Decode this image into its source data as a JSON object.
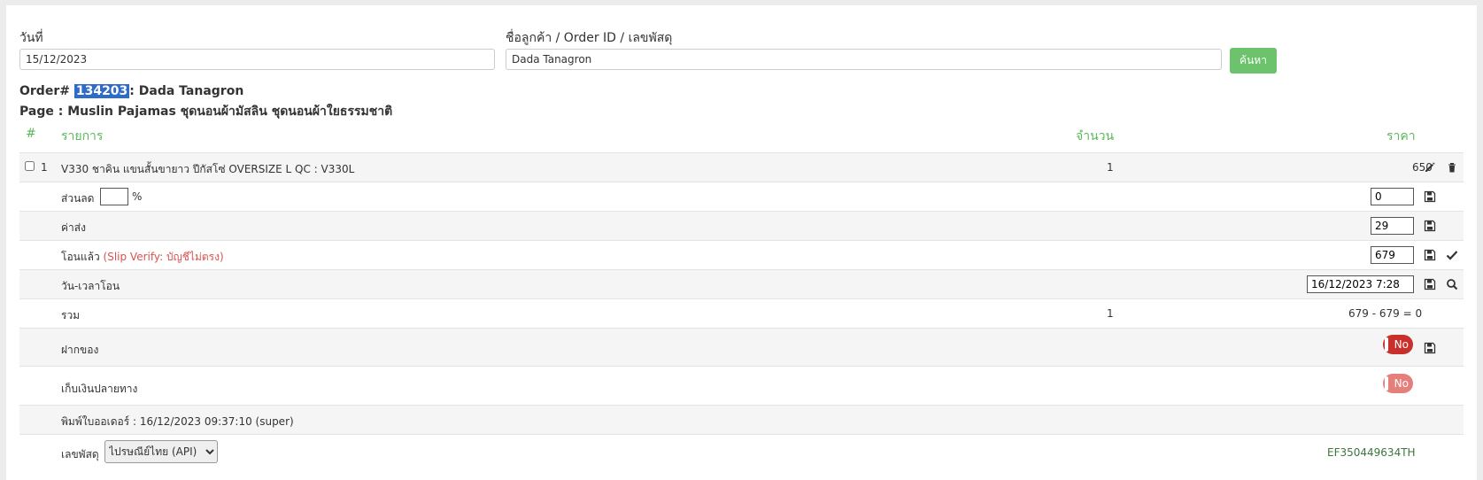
{
  "search": {
    "date_label": "วันที่",
    "date_value": "15/12/2023",
    "query_label": "ชื่อลูกค้า / Order ID / เลขพัสดุ",
    "query_value": "Dada Tanagron",
    "button_label": "ค้นหา"
  },
  "order": {
    "prefix": "Order#",
    "id": "134203",
    "customer": ": Dada Tanagron",
    "page_line": "Page : Muslin Pajamas ชุดนอนผ้ามัสลิน ชุดนอนผ้าใยธรรมชาติ"
  },
  "table": {
    "headers": {
      "index": "#",
      "item": "รายการ",
      "qty": "จำนวน",
      "price": "ราคา"
    },
    "item": {
      "index": "1",
      "name": "V330 ชาคิน แขนสั้นขายาว ปีกัสโซ่ OVERSIZE L QC : V330L",
      "qty": "1",
      "price": "650"
    },
    "discount": {
      "label": "ส่วนลด",
      "percent_sign": "%",
      "value": "0"
    },
    "shipping": {
      "label": "ค่าส่ง",
      "value": "29"
    },
    "transferred": {
      "label": "โอนแล้ว",
      "verify_note": "(Slip Verify: บัญชีไม่ตรง)",
      "value": "679"
    },
    "transfer_time": {
      "label": "วัน-เวลาโอน",
      "value": "16/12/2023 7:28"
    },
    "total": {
      "label": "รวม",
      "qty": "1",
      "calc": "679 - 679 = 0"
    },
    "deposit": {
      "label": "ฝากของ",
      "toggle": "No"
    },
    "cod": {
      "label": "เก็บเงินปลายทาง",
      "toggle": "No"
    },
    "printed": {
      "label": "พิมพ์ใบออเดอร์ : 16/12/2023 09:37:10 (super)"
    },
    "tracking": {
      "label": "เลขพัสดุ",
      "carrier": "ไปรษณีย์ไทย (API)",
      "number": "EF350449634TH"
    }
  },
  "colors": {
    "accent_green": "#5cb85c",
    "danger_red": "#d9534f",
    "toggle_red": "#c9302c",
    "toggle_faded": "#e57f7c",
    "highlight": "#2f6bc9"
  }
}
